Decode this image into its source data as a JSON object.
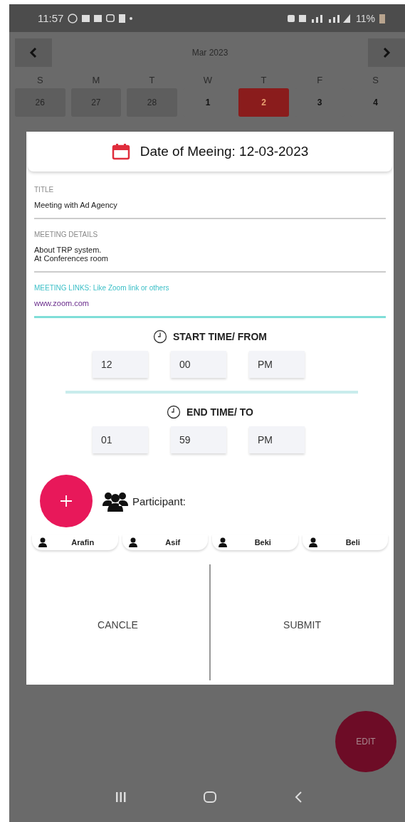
{
  "status_bar": {
    "time": "11:57",
    "battery": "11%"
  },
  "calendar": {
    "month": "Mar 2023",
    "weekdays": [
      "S",
      "M",
      "T",
      "W",
      "T",
      "F",
      "S"
    ],
    "days": [
      {
        "label": "26",
        "outside": true,
        "selected": false
      },
      {
        "label": "27",
        "outside": true,
        "selected": false
      },
      {
        "label": "28",
        "outside": true,
        "selected": false
      },
      {
        "label": "1",
        "outside": false,
        "selected": false
      },
      {
        "label": "2",
        "outside": false,
        "selected": true
      },
      {
        "label": "3",
        "outside": false,
        "selected": false
      },
      {
        "label": "4",
        "outside": false,
        "selected": false
      }
    ]
  },
  "dialog": {
    "title": "Date of Meeing: 12-03-2023",
    "fields": [
      {
        "label": "TITLE",
        "value": "Meeting with Ad Agency",
        "focused": false
      },
      {
        "label": "MEETING DETAILS",
        "value": "About TRP system.\nAt Conferences room",
        "focused": false
      },
      {
        "label": "MEETING LINKS: Like Zoom link or others",
        "value": "www.zoom.com",
        "focused": true
      }
    ],
    "start": {
      "label": "START TIME/ FROM",
      "hour": "12",
      "minute": "00",
      "period": "PM"
    },
    "end": {
      "label": "END TIME/ TO",
      "hour": "01",
      "minute": "59",
      "period": "PM"
    },
    "participant_label": "Participant:",
    "participants": [
      "Arafin",
      "Asif",
      "Beki",
      "Beli"
    ],
    "buttons": [
      "CANCLE",
      "SUBMIT"
    ]
  },
  "fab": {
    "label": "EDIT"
  }
}
